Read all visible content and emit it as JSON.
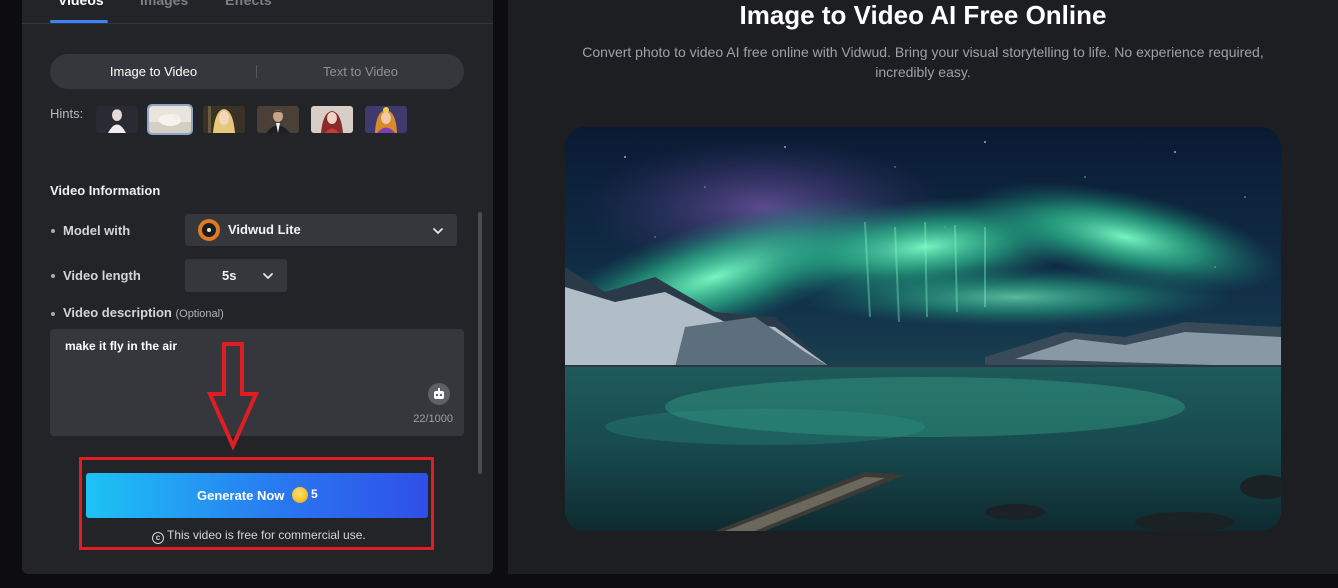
{
  "top_tabs": [
    {
      "label": "Videos",
      "active": true
    },
    {
      "label": "Images",
      "active": false
    },
    {
      "label": "Effects",
      "active": false
    }
  ],
  "mode_switch": {
    "options": [
      "Image to Video",
      "Text to Video"
    ],
    "selected": "Image to Video"
  },
  "hints": {
    "label": "Hints:",
    "selected_index": 1
  },
  "video_information": {
    "title": "Video Information",
    "model": {
      "label": "Model with",
      "value": "Vidwud Lite"
    },
    "length": {
      "label": "Video length",
      "value": "5s"
    },
    "description": {
      "label": "Video description",
      "optional": "(Optional)",
      "value": "make it fly in the air",
      "char_count": "22/1000"
    }
  },
  "generate": {
    "label": "Generate Now",
    "cost": "5",
    "note": "This video is free for commercial use."
  },
  "hero": {
    "title": "Image to Video AI Free Online",
    "subtitle": "Convert photo to video AI free online with Vidwud. Bring your visual storytelling to life. No experience required, incredibly easy."
  },
  "colors": {
    "accent": "#3b82f6",
    "highlight": "#e11d24",
    "button_start": "#1dc3f5",
    "button_end": "#2f4fe8"
  }
}
